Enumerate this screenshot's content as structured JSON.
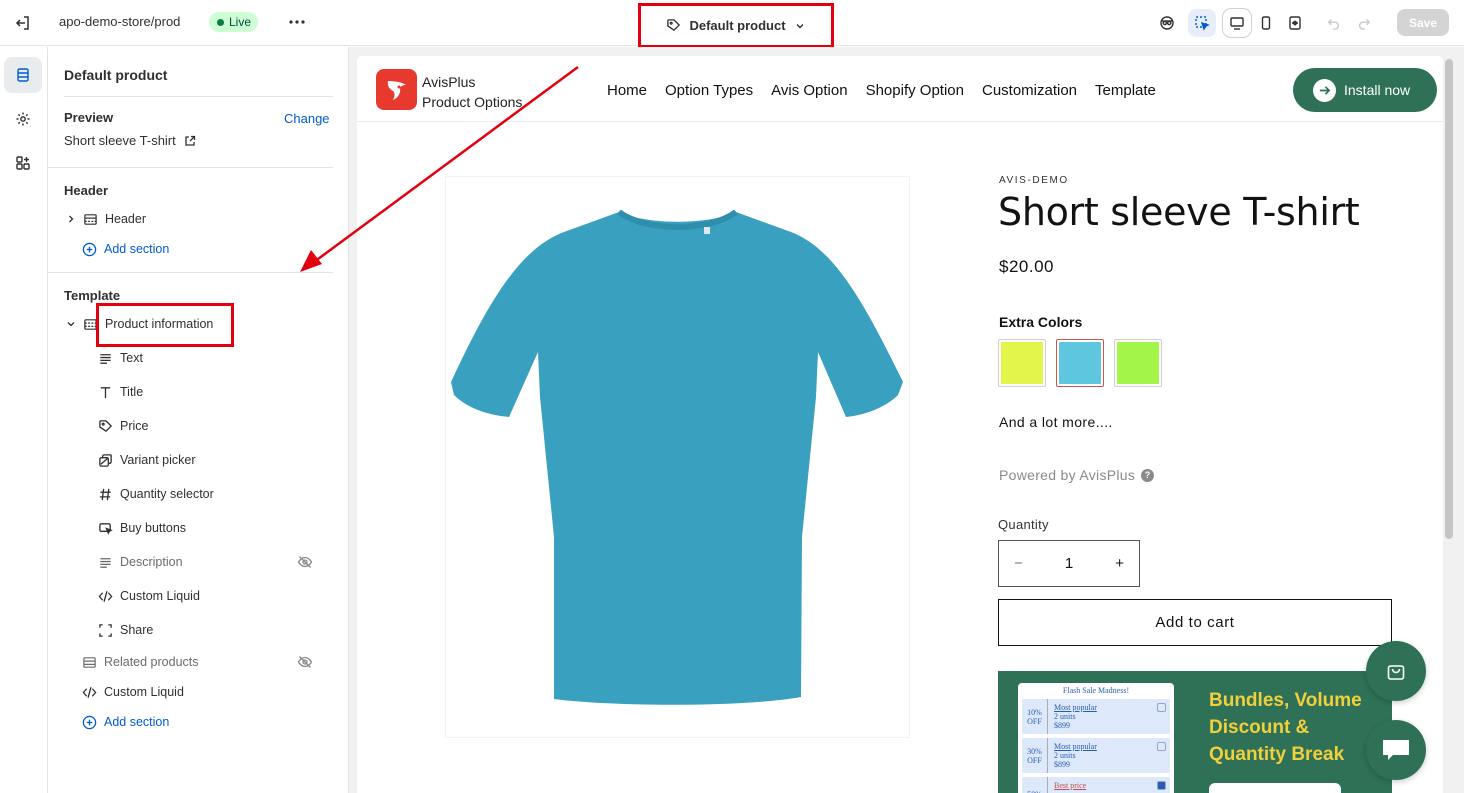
{
  "topbar": {
    "store_path": "apo-demo-store/prod",
    "live_label": "Live",
    "template_name": "Default product",
    "save_label": "Save"
  },
  "panel": {
    "title": "Default product",
    "preview_heading": "Preview",
    "change_label": "Change",
    "preview_value": "Short sleeve T-shirt",
    "header_heading": "Header",
    "header_item": "Header",
    "add_section": "Add section",
    "template_heading": "Template",
    "product_info": "Product information",
    "blocks": [
      {
        "label": "Text",
        "icon": "text-lines-icon",
        "hidden": false
      },
      {
        "label": "Title",
        "icon": "title-t-icon",
        "hidden": false
      },
      {
        "label": "Price",
        "icon": "price-tag-icon",
        "hidden": false
      },
      {
        "label": "Variant picker",
        "icon": "variant-picker-icon",
        "hidden": false
      },
      {
        "label": "Quantity selector",
        "icon": "hash-icon",
        "hidden": false
      },
      {
        "label": "Buy buttons",
        "icon": "buy-buttons-icon",
        "hidden": false
      },
      {
        "label": "Description",
        "icon": "text-lines-icon",
        "hidden": true
      },
      {
        "label": "Custom Liquid",
        "icon": "code-icon",
        "hidden": false
      },
      {
        "label": "Share",
        "icon": "share-frame-icon",
        "hidden": false
      }
    ],
    "related_products": "Related products",
    "custom_liquid": "Custom Liquid",
    "add_section_2": "Add section"
  },
  "site": {
    "logo_line1": "AvisPlus",
    "logo_line2": "Product Options",
    "nav": [
      "Home",
      "Option Types",
      "Avis Option",
      "Shopify Option",
      "Customization",
      "Template"
    ],
    "install_label": "Install now"
  },
  "product": {
    "vendor": "AVIS-DEMO",
    "title": "Short sleeve T-shirt",
    "price": "$20.00",
    "extra_colors_label": "Extra Colors",
    "swatches": [
      "#e1f54a",
      "#5ec6df",
      "#a3f54a"
    ],
    "more_text": "And a lot more....",
    "powered_by": "Powered by AvisPlus",
    "quantity_label": "Quantity",
    "quantity_value": "1",
    "minus": "−",
    "plus": "+",
    "add_to_cart": "Add to cart",
    "tshirt_color": "#3aa0c0"
  },
  "banner": {
    "card_header": "Flash Sale Madness!",
    "rows": [
      {
        "off": "10% OFF",
        "tag": "Most popular",
        "units": "2 units",
        "price": "$899"
      },
      {
        "off": "30% OFF",
        "tag": "Most popular",
        "units": "2 units",
        "price": "$899"
      },
      {
        "off": "50%",
        "tag": "Best price",
        "units": "",
        "price": ""
      }
    ],
    "title_line1": "Bundles, Volume",
    "title_line2": "Discount &",
    "title_line3": "Quantity Break"
  },
  "colors": {
    "accent_green": "#2e7156",
    "highlight_red": "#e3000f",
    "link_blue": "#005bd3"
  }
}
